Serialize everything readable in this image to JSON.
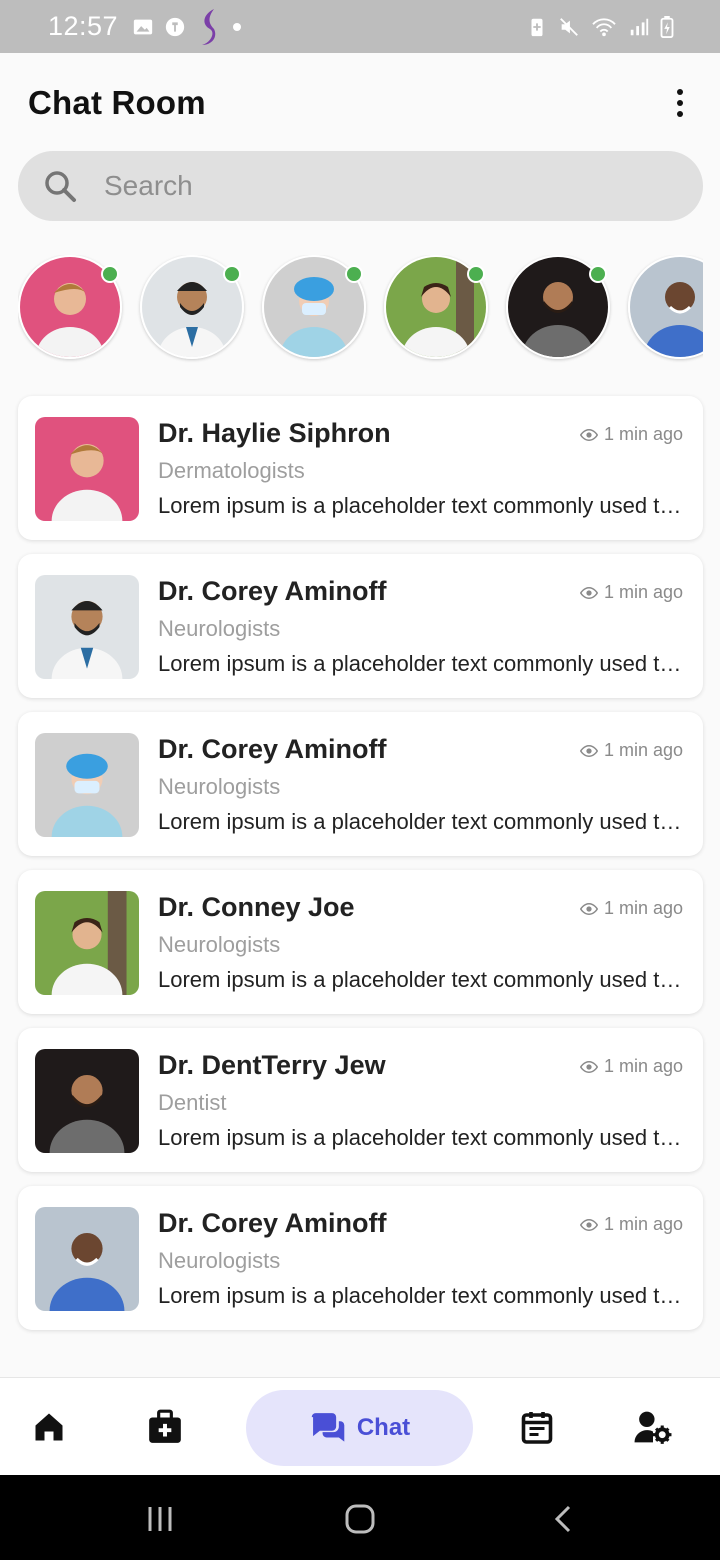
{
  "status_bar": {
    "time": "12:57"
  },
  "header": {
    "title": "Chat Room"
  },
  "search": {
    "placeholder": "Search"
  },
  "colors": {
    "accent": "#4a4fd6",
    "accent_bg": "#e5e4fb",
    "online": "#4caf50"
  },
  "stories": [
    {
      "name": "Dr. Haylie Siphron",
      "online": true
    },
    {
      "name": "Dr. Corey Aminoff",
      "online": true
    },
    {
      "name": "Dr. Corey Aminoff",
      "online": true
    },
    {
      "name": "Dr. Conney Joe",
      "online": true
    },
    {
      "name": "Dr. DentTerry Jew",
      "online": true
    },
    {
      "name": "Dr. Corey Aminoff",
      "online": false
    }
  ],
  "chats": [
    {
      "name": "Dr. Haylie Siphron",
      "specialty": "Dermatologists",
      "time": "1 min ago",
      "message": "Lorem ipsum is a placeholder text commonly used to demonstrate the visual form"
    },
    {
      "name": "Dr. Corey Aminoff",
      "specialty": "Neurologists",
      "time": "1 min ago",
      "message": "Lorem ipsum is a placeholder text commonly used to demonstrate the visual form"
    },
    {
      "name": "Dr. Corey Aminoff",
      "specialty": "Neurologists",
      "time": "1 min ago",
      "message": "Lorem ipsum is a placeholder text commonly used to demonstrate the visual form"
    },
    {
      "name": "Dr. Conney Joe",
      "specialty": "Neurologists",
      "time": "1 min ago",
      "message": "Lorem ipsum is a placeholder text commonly used to demonstrate the visual form"
    },
    {
      "name": "Dr. DentTerry Jew",
      "specialty": "Dentist",
      "time": "1 min ago",
      "message": "Lorem ipsum is a placeholder text commonly used to demonstrate the visual form"
    },
    {
      "name": "Dr. Corey Aminoff",
      "specialty": "Neurologists",
      "time": "1 min ago",
      "message": "Lorem ipsum is a placeholder text commonly used to demonstrate the visual form"
    }
  ],
  "bottom_nav": {
    "items": [
      {
        "icon": "home-icon"
      },
      {
        "icon": "medical-kit-icon"
      },
      {
        "icon": "chat-icon",
        "label": "Chat",
        "active": true
      },
      {
        "icon": "calendar-icon"
      },
      {
        "icon": "user-settings-icon"
      }
    ]
  }
}
